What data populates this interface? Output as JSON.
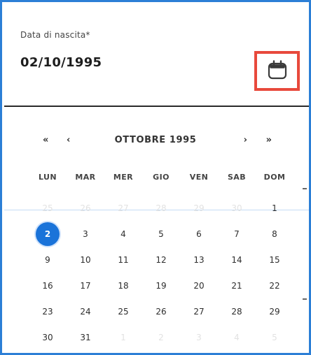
{
  "field": {
    "label": "Data di nascita*",
    "value": "02/10/1995",
    "calendar_icon": "calendar-icon"
  },
  "calendar": {
    "month_label": "OTTOBRE 1995",
    "nav": {
      "prev_year": "«",
      "prev_month": "‹",
      "next_month": "›",
      "next_year": "»"
    },
    "weekdays": [
      "LUN",
      "MAR",
      "MER",
      "GIO",
      "VEN",
      "SAB",
      "DOM"
    ],
    "days": [
      {
        "label": "25",
        "muted": true
      },
      {
        "label": "26",
        "muted": true
      },
      {
        "label": "27",
        "muted": true
      },
      {
        "label": "28",
        "muted": true
      },
      {
        "label": "29",
        "muted": true
      },
      {
        "label": "30",
        "muted": true
      },
      {
        "label": "1"
      },
      {
        "label": "2",
        "selected": true
      },
      {
        "label": "3"
      },
      {
        "label": "4"
      },
      {
        "label": "5"
      },
      {
        "label": "6"
      },
      {
        "label": "7"
      },
      {
        "label": "8"
      },
      {
        "label": "9"
      },
      {
        "label": "10"
      },
      {
        "label": "11"
      },
      {
        "label": "12"
      },
      {
        "label": "13"
      },
      {
        "label": "14"
      },
      {
        "label": "15"
      },
      {
        "label": "16"
      },
      {
        "label": "17"
      },
      {
        "label": "18"
      },
      {
        "label": "19"
      },
      {
        "label": "20"
      },
      {
        "label": "21"
      },
      {
        "label": "22"
      },
      {
        "label": "23"
      },
      {
        "label": "24"
      },
      {
        "label": "25"
      },
      {
        "label": "26"
      },
      {
        "label": "27"
      },
      {
        "label": "28"
      },
      {
        "label": "29"
      },
      {
        "label": "30"
      },
      {
        "label": "31"
      },
      {
        "label": "1",
        "muted": true
      },
      {
        "label": "2",
        "muted": true
      },
      {
        "label": "3",
        "muted": true
      },
      {
        "label": "4",
        "muted": true
      },
      {
        "label": "5",
        "muted": true
      }
    ]
  },
  "colors": {
    "accent": "#1a73d9",
    "frame": "#2c7fd6",
    "highlight_box": "#e8493c"
  }
}
